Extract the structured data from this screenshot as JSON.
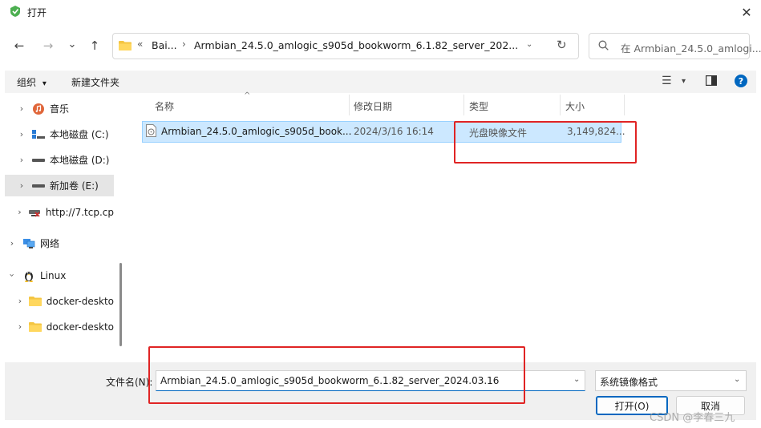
{
  "window": {
    "title": "打开",
    "close_glyph": "✕",
    "app_icon": "app-shield-icon"
  },
  "nav": {
    "back_glyph": "←",
    "forward_glyph": "→",
    "recent_glyph": "⌄",
    "up_glyph": "↑",
    "breadcrumb": {
      "overflow": "«",
      "part1": "Bai...",
      "sep": "›",
      "part2": "Armbian_24.5.0_amlogic_s905d_bookworm_6.1.82_server_202..."
    },
    "address_dropdown_glyph": "⌄",
    "refresh_glyph": "↻",
    "search_placeholder": "在 Armbian_24.5.0_amlogi..."
  },
  "toolbar": {
    "organize_label": "组织",
    "organize_caret": "▾",
    "new_folder_label": "新建文件夹",
    "view_glyph": "☰",
    "view_caret": "▾",
    "help_glyph": "?"
  },
  "sidebar": {
    "items": [
      {
        "label": "音乐",
        "icon": "music-icon"
      },
      {
        "label": "本地磁盘 (C:)",
        "icon": "windows-drive-icon"
      },
      {
        "label": "本地磁盘 (D:)",
        "icon": "drive-icon"
      },
      {
        "label": "新加卷 (E:)",
        "icon": "drive-icon"
      },
      {
        "label": "http://7.tcp.cp",
        "icon": "network-drive-icon"
      },
      {
        "label": "网络",
        "icon": "network-icon"
      },
      {
        "label": "Linux",
        "icon": "linux-icon"
      },
      {
        "label": "docker-deskto",
        "icon": "folder-icon"
      },
      {
        "label": "docker-deskto",
        "icon": "folder-icon"
      }
    ]
  },
  "columns": {
    "name": "名称",
    "modified": "修改日期",
    "type": "类型",
    "size": "大小",
    "sort_glyph": "^"
  },
  "files": [
    {
      "name": "Armbian_24.5.0_amlogic_s905d_book...",
      "modified": "2024/3/16 16:14",
      "type": "光盘映像文件",
      "size": "3,149,824..."
    }
  ],
  "footer": {
    "filename_label": "文件名(N):",
    "filename_value": "Armbian_24.5.0_amlogic_s905d_bookworm_6.1.82_server_2024.03.16",
    "filetype_value": "系统镜像格式",
    "open_label": "打开(O)",
    "cancel_label": "取消",
    "dropdown_glyph": "⌄"
  },
  "watermark": "CSDN @李春三九",
  "colors": {
    "selection": "#cce8ff",
    "accent": "#0067c0",
    "highlight_box": "#e02424",
    "help": "#0067c0"
  }
}
